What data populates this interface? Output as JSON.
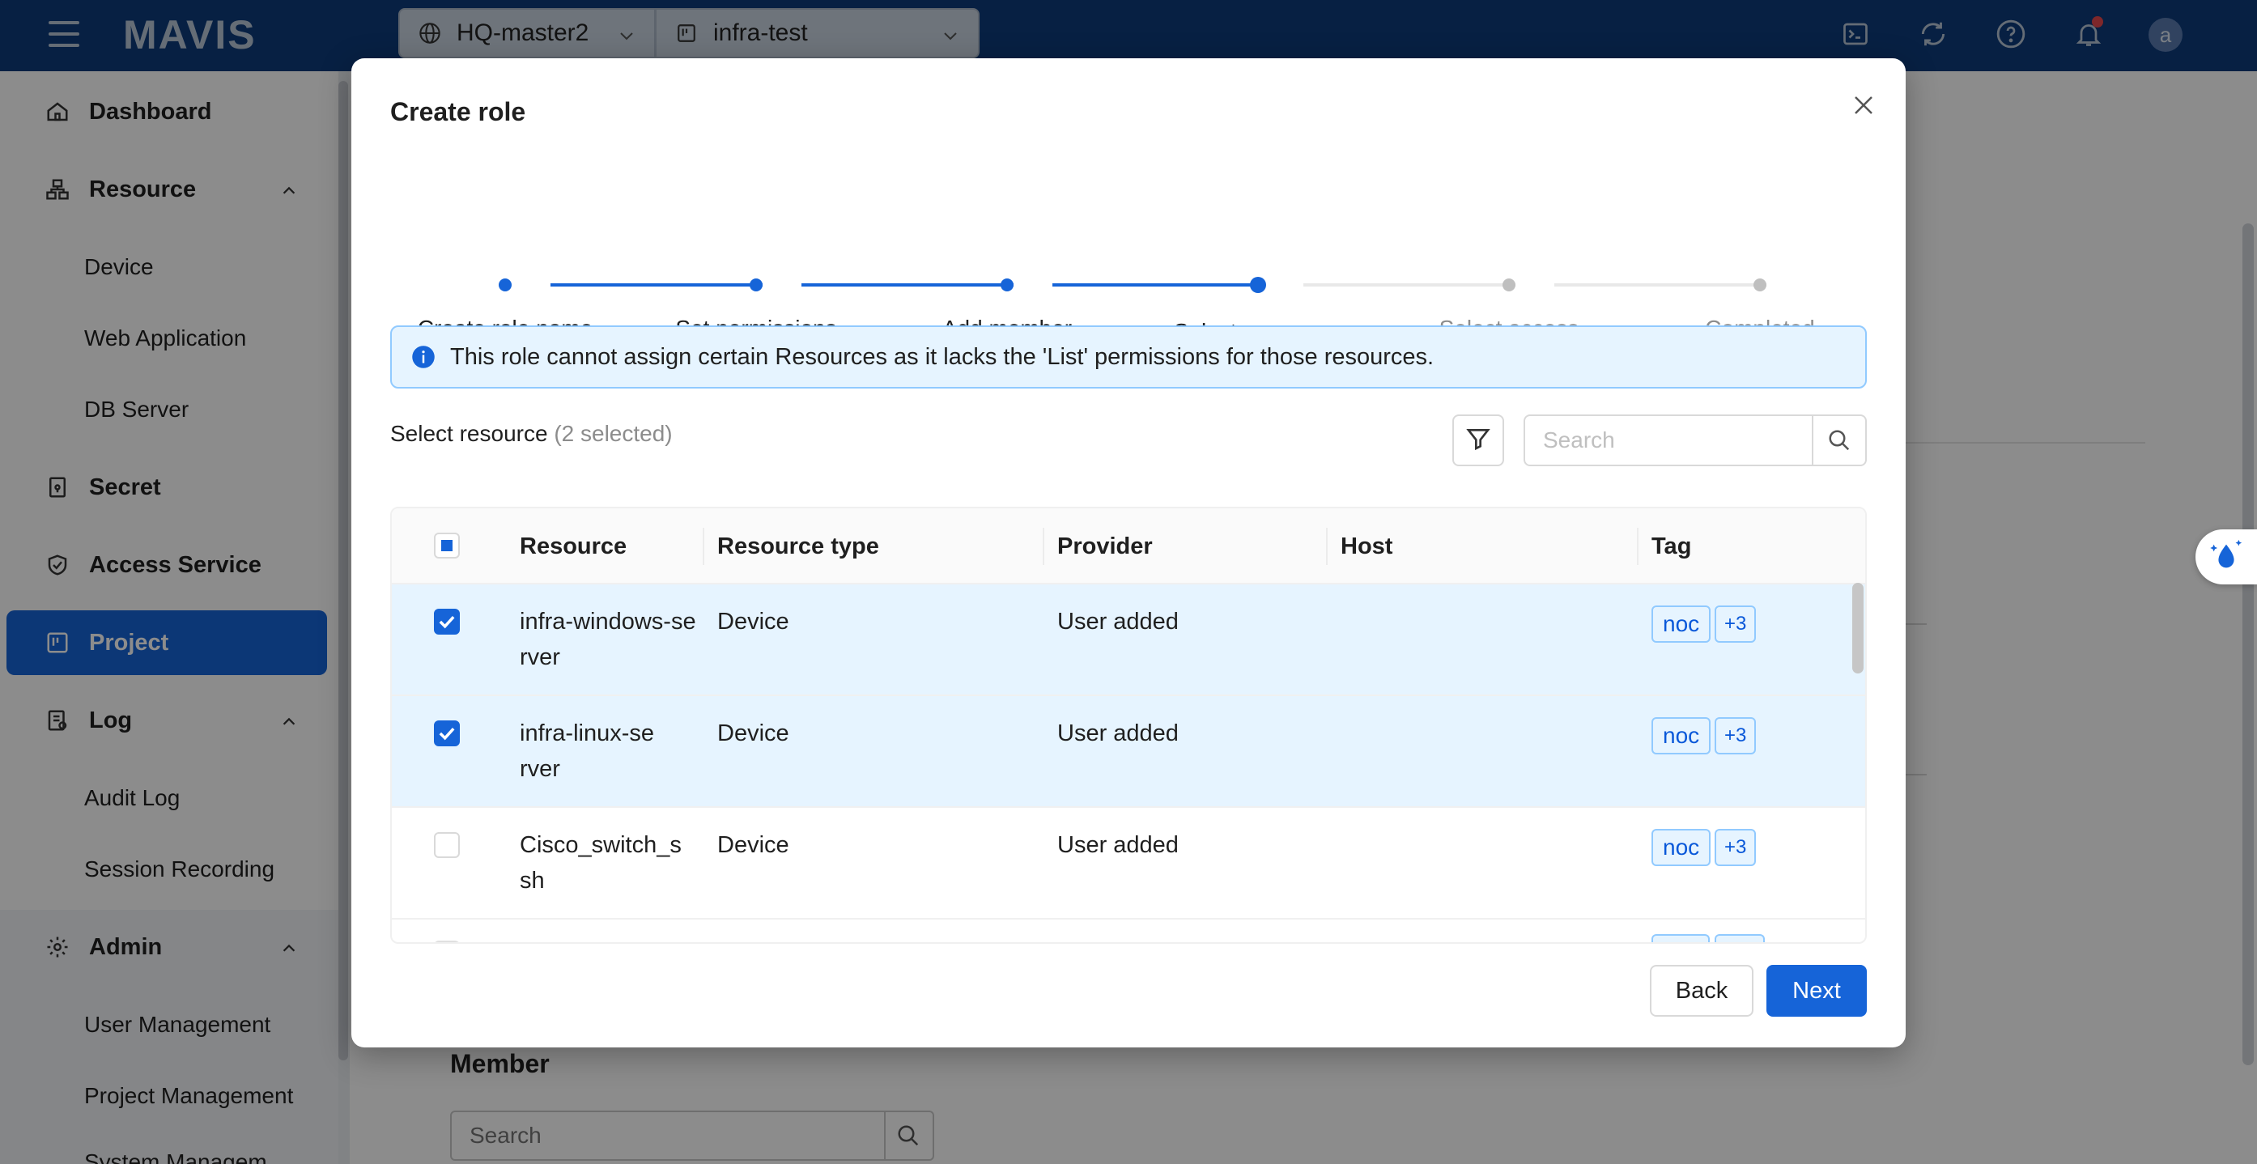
{
  "topbar": {
    "logo": "MAVIS",
    "selectors": [
      {
        "label": "HQ-master2",
        "icon": "globe-icon"
      },
      {
        "label": "infra-test",
        "icon": "project-icon"
      }
    ],
    "icons": [
      "terminal-icon",
      "sync-icon",
      "help-icon",
      "bell-icon"
    ],
    "avatar": "a",
    "colors": {
      "bar": "#0d3b7a",
      "notification_dot": "#e5484d"
    }
  },
  "sidebar": {
    "items": [
      {
        "label": "Dashboard",
        "icon": "home-icon"
      },
      {
        "label": "Resource",
        "icon": "resource-icon",
        "expanded": true
      },
      {
        "label": "Device"
      },
      {
        "label": "Web Application"
      },
      {
        "label": "DB Server"
      },
      {
        "label": "Secret",
        "icon": "secret-icon"
      },
      {
        "label": "Access Service",
        "icon": "shield-check-icon"
      },
      {
        "label": "Project",
        "icon": "project-icon",
        "active": true
      },
      {
        "label": "Log",
        "icon": "log-icon",
        "expanded": true
      },
      {
        "label": "Audit Log"
      },
      {
        "label": "Session Recording"
      },
      {
        "label": "Admin",
        "icon": "gear-icon",
        "expanded": true
      },
      {
        "label": "User Management"
      },
      {
        "label": "Project Management"
      },
      {
        "label": "System Managem..."
      }
    ]
  },
  "background": {
    "member_title": "Member",
    "member_search_placeholder": "Search"
  },
  "modal": {
    "title": "Create role",
    "steps": [
      {
        "label": "Create role name",
        "status": "done"
      },
      {
        "label": "Set permissions",
        "status": "done"
      },
      {
        "label": "Add member",
        "status": "done"
      },
      {
        "label": "Select resources",
        "status": "current"
      },
      {
        "label": "Select access services",
        "status": "todo"
      },
      {
        "label": "Completed",
        "status": "todo"
      }
    ],
    "alert": "This role cannot assign certain Resources as it lacks the 'List' permissions for those resources.",
    "select_label": "Select resource",
    "selected_count": "(2 selected)",
    "search_placeholder": "Search",
    "table": {
      "columns": [
        "Resource",
        "Resource type",
        "Provider",
        "Host",
        "Tag"
      ],
      "rows": [
        {
          "resource": "infra-windows-server",
          "type": "Device",
          "provider": "User added",
          "host": "",
          "tag": "noc",
          "more": "+3",
          "checked": true
        },
        {
          "resource": "infra-linux-server",
          "type": "Device",
          "provider": "User added",
          "host": "",
          "tag": "noc",
          "more": "+3",
          "checked": true
        },
        {
          "resource": "Cisco_switch_ssh",
          "type": "Device",
          "provider": "User added",
          "host": "",
          "tag": "noc",
          "more": "+3",
          "checked": false
        }
      ]
    },
    "back_label": "Back",
    "next_label": "Next",
    "colors": {
      "primary": "#1664d8",
      "selected_row": "#e6f4ff",
      "tag_border": "#91caff"
    }
  }
}
